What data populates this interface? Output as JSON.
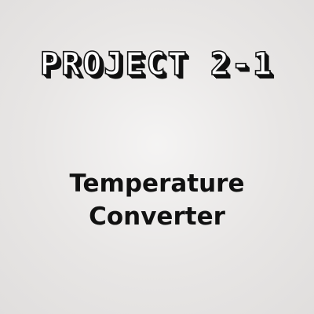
{
  "title": "PROJECT 2-1",
  "subtitle": {
    "line1": "Temperature",
    "line2": "Converter"
  },
  "colors": {
    "background": "#e8e6e5",
    "title_fill": "#ffffff",
    "title_outline": "#111111",
    "subtitle_text": "#111111"
  }
}
